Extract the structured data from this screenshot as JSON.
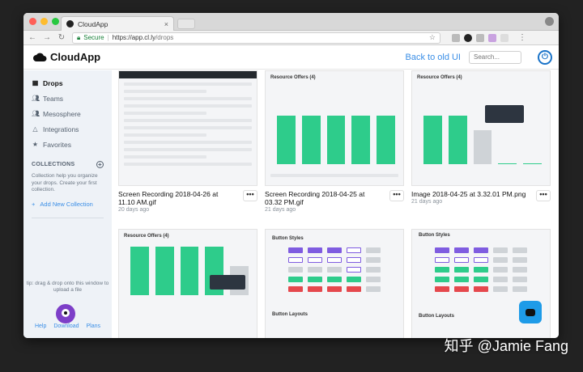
{
  "browser": {
    "tab_title": "CloudApp",
    "secure_label": "Secure",
    "url_host": "https://app.cl.ly",
    "url_path": "/drops"
  },
  "header": {
    "logo_text": "CloudApp",
    "back_link": "Back to old UI",
    "search_placeholder": "Search..."
  },
  "sidebar": {
    "items": [
      {
        "label": "Drops",
        "icon": "grid-icon"
      },
      {
        "label": "Teams",
        "icon": "users-icon"
      },
      {
        "label": "Mesosphere",
        "icon": "users-icon"
      },
      {
        "label": "Integrations",
        "icon": "triangle-icon"
      },
      {
        "label": "Favorites",
        "icon": "star-icon"
      }
    ],
    "collections_heading": "COLLECTIONS",
    "collections_text": "Collection help you organize your drops. Create your first collection.",
    "add_collection": "Add New Collection",
    "tip": "tip: drag & drop onto this window to upload a file",
    "footer": [
      "Help",
      "Download",
      "Plans"
    ]
  },
  "drops": [
    {
      "title": "Screen Recording 2018-04-26 at 11.10 AM.gif",
      "date": "20 days ago"
    },
    {
      "title": "Screen Recording 2018-04-25 at 03.32 PM.gif",
      "date": "21 days ago"
    },
    {
      "title": "Image 2018-04-25 at 3.32.01 PM.png",
      "date": "21 days ago"
    },
    {
      "title": "",
      "date": ""
    },
    {
      "title": "",
      "date": ""
    },
    {
      "title": "",
      "date": ""
    }
  ],
  "thumb_labels": {
    "resource_offers": "Resource Offers (4)",
    "button_styles": "Button Styles",
    "button_layouts": "Button Layouts"
  },
  "more_label": "•••",
  "watermark": "知乎 @Jamie Fang",
  "colors": {
    "accent": "#3a8ee6",
    "chart_green": "#2ecc8b",
    "brand_purple": "#7d3fc8",
    "chat_blue": "#1e9be8"
  }
}
